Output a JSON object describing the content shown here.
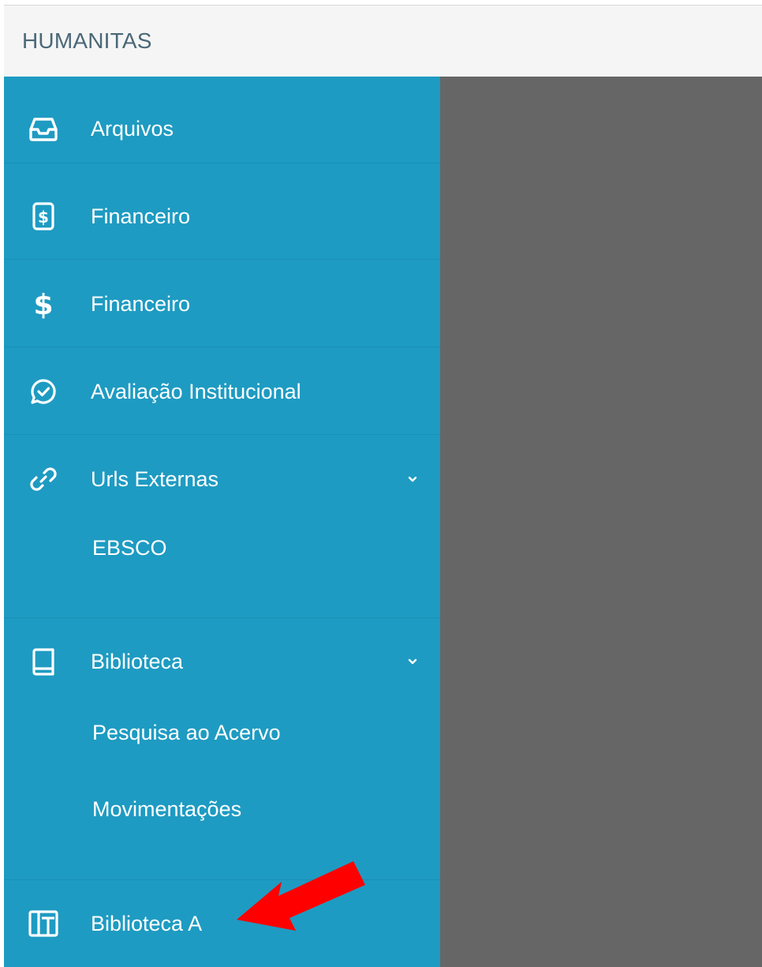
{
  "header": {
    "brand": "HUMANITAS"
  },
  "sidebar": {
    "items": [
      {
        "label": "Arquivos",
        "icon": "inbox-icon"
      },
      {
        "label": "Financeiro",
        "icon": "invoice-dollar-icon"
      },
      {
        "label": "Financeiro",
        "icon": "dollar-icon"
      },
      {
        "label": "Avaliação Institucional",
        "icon": "chat-check-icon"
      },
      {
        "label": "Urls Externas",
        "icon": "link-icon",
        "expanded": true,
        "children": [
          {
            "label": "EBSCO"
          }
        ]
      },
      {
        "label": "Biblioteca",
        "icon": "book-icon",
        "expanded": true,
        "children": [
          {
            "label": "Pesquisa ao Acervo"
          },
          {
            "label": "Movimentações"
          }
        ]
      },
      {
        "label": "Biblioteca A",
        "icon": "library-columns-icon"
      }
    ]
  },
  "colors": {
    "sidebar_bg": "#1e9bc2",
    "header_bg": "#f5f5f5",
    "overlay_bg": "#666666",
    "annotation_arrow": "#ff0000"
  }
}
